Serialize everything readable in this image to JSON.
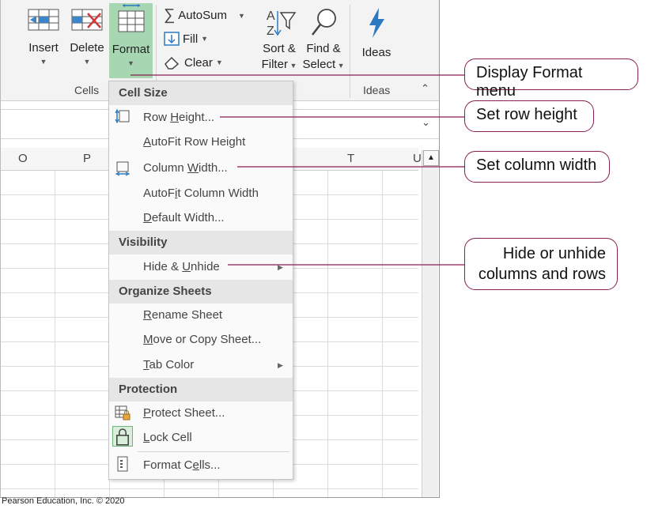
{
  "ribbon": {
    "cells_group": {
      "insert": "Insert",
      "delete": "Delete",
      "format": "Format",
      "label": "Cells"
    },
    "editing_group": {
      "autosum": "AutoSum",
      "fill": "Fill",
      "clear": "Clear",
      "sort_filter_line1": "Sort &",
      "sort_filter_line2": "Filter",
      "find_select_line1": "Find &",
      "find_select_line2": "Select"
    },
    "ideas_group": {
      "ideas": "Ideas",
      "label": "Ideas"
    }
  },
  "columns": [
    "O",
    "P",
    "T",
    "U"
  ],
  "format_menu": {
    "cell_size": {
      "header": "Cell Size",
      "row_height": {
        "u": "H",
        "pre": "Row ",
        "post": "eight..."
      },
      "autofit_row_height": {
        "u": "A",
        "pre": "",
        "post": "utoFit Row Height"
      },
      "column_width": {
        "u": "W",
        "pre": "Column ",
        "post": "idth..."
      },
      "autofit_column_width": {
        "u": "i",
        "pre": "AutoF",
        "post": "t Column Width"
      },
      "default_width": {
        "u": "D",
        "pre": "",
        "post": "efault Width..."
      }
    },
    "visibility": {
      "header": "Visibility",
      "hide_unhide": {
        "u": "U",
        "pre": "Hide & ",
        "post": "nhide"
      }
    },
    "organize_sheets": {
      "header": "Organize Sheets",
      "rename_sheet": {
        "u": "R",
        "pre": "",
        "post": "ename Sheet"
      },
      "move_copy_sheet": {
        "u": "M",
        "pre": "",
        "post": "ove or Copy Sheet..."
      },
      "tab_color": {
        "u": "T",
        "pre": "",
        "post": "ab Color"
      }
    },
    "protection": {
      "header": "Protection",
      "protect_sheet": {
        "u": "P",
        "pre": "",
        "post": "rotect Sheet..."
      },
      "lock_cell": {
        "u": "L",
        "pre": "",
        "post": "ock Cell"
      },
      "format_cells": {
        "u": "e",
        "pre": "Format C",
        "post": "lls..."
      }
    }
  },
  "callouts": {
    "display_format_menu": "Display Format menu",
    "set_row_height": "Set row height",
    "set_column_width": "Set column width",
    "hide_unhide_line1": "Hide or unhide",
    "hide_unhide_line2": "columns and rows"
  },
  "footer": "Pearson Education, Inc. © 2020",
  "colors": {
    "callout_border": "#8a1f52",
    "format_highlight": "#a6d7b2",
    "accent_blue": "#2b79c2"
  },
  "icons": [
    "insert-cells-icon",
    "delete-cells-icon",
    "format-icon",
    "sigma-icon",
    "fill-down-icon",
    "eraser-icon",
    "sort-filter-icon",
    "magnifier-icon",
    "lightning-icon",
    "row-height-icon",
    "column-width-icon",
    "protect-sheet-icon",
    "lock-icon",
    "format-cells-icon",
    "submenu-arrow-icon"
  ]
}
